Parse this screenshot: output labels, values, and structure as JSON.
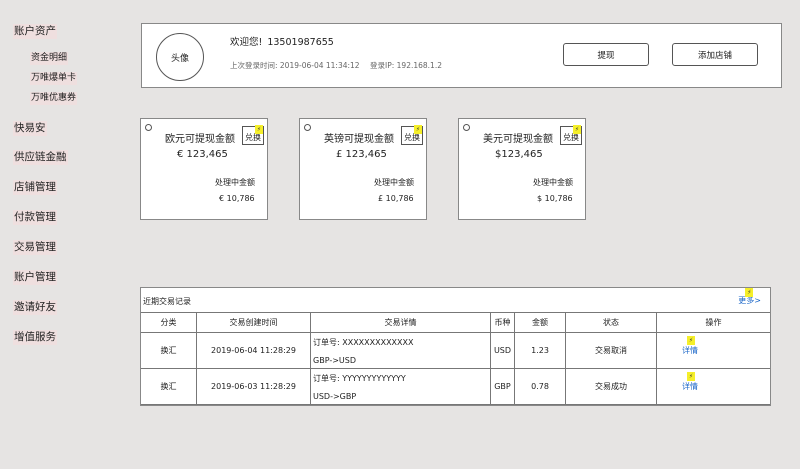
{
  "sidebar": {
    "groups": [
      {
        "label": "账户资产",
        "sub": [
          "资金明细",
          "万唯爆单卡",
          "万唯优惠券"
        ]
      },
      {
        "label": "快易安"
      },
      {
        "label": "供应链金融"
      },
      {
        "label": "店铺管理"
      },
      {
        "label": "付款管理"
      },
      {
        "label": "交易管理"
      },
      {
        "label": "账户管理"
      },
      {
        "label": "邀请好友"
      },
      {
        "label": "增值服务"
      }
    ]
  },
  "profile": {
    "avatar_label": "头像",
    "welcome": "欢迎您!",
    "phone": "13501987655",
    "last_login": "上次登录时间: 2019-06-04 11:34:12",
    "login_ip": "登录IP: 192.168.1.2",
    "withdraw_button": "提现",
    "add_store_button": "添加店铺"
  },
  "balances": [
    {
      "title": "欧元可提现金额",
      "amount": "€ 123,465",
      "pending_label": "处理中金额",
      "pending_amount": "€ 10,786",
      "exchange_label": "兑换"
    },
    {
      "title": "英镑可提现金额",
      "amount": "£ 123,465",
      "pending_label": "处理中金额",
      "pending_amount": "£ 10,786",
      "exchange_label": "兑换"
    },
    {
      "title": "美元可提现金额",
      "amount": "$123,465",
      "pending_label": "处理中金额",
      "pending_amount": "$ 10,786",
      "exchange_label": "兑换"
    }
  ],
  "transactions": {
    "title": "近期交易记录",
    "more": "更多>",
    "columns": [
      "分类",
      "交易创建时间",
      "交易详情",
      "币种",
      "金额",
      "状态",
      "操作"
    ],
    "rows": [
      {
        "category": "换汇",
        "time": "2019-06-04 11:28:29",
        "order": "订单号: XXXXXXXXXXXXX",
        "route": "GBP->USD",
        "currency": "USD",
        "amount": "1.23",
        "status": "交易取消",
        "action": "详情"
      },
      {
        "category": "换汇",
        "time": "2019-06-03 11:28:29",
        "order": "订单号: YYYYYYYYYYYYY",
        "route": "USD->GBP",
        "currency": "GBP",
        "amount": "0.78",
        "status": "交易成功",
        "action": "详情"
      }
    ]
  },
  "colors": {
    "background": "#e6e4e3",
    "nav_highlight": "#efdfdf",
    "link": "#1a66c8",
    "bolt": "#f5ef2a"
  },
  "icons": {
    "bolt": "lightning-bolt-icon",
    "radio": "radio-icon"
  }
}
